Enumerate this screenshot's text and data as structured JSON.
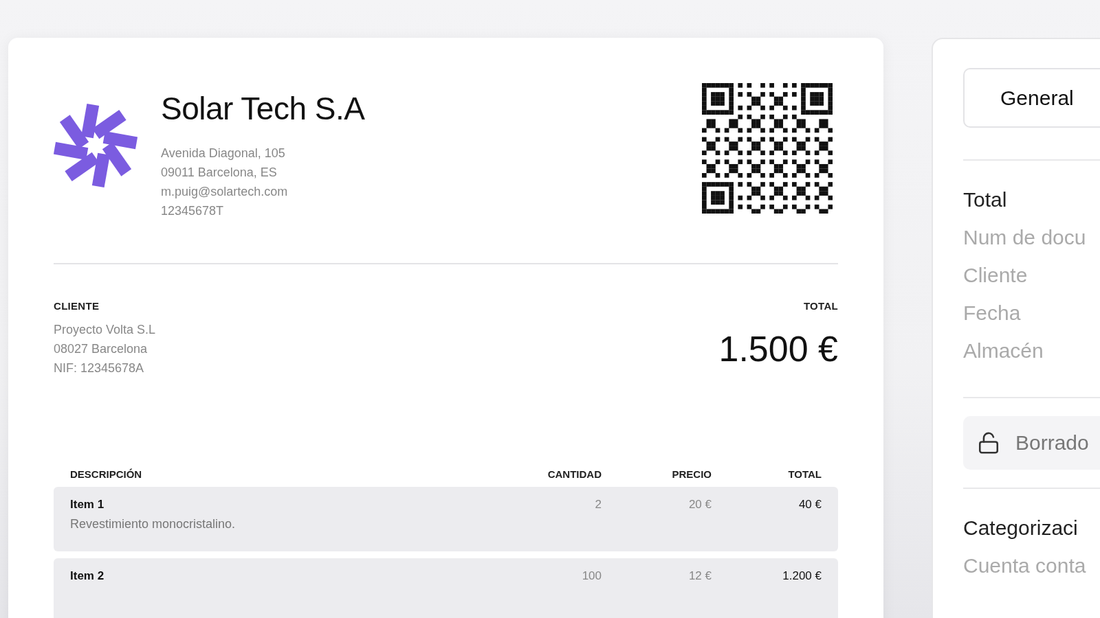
{
  "invoice": {
    "company": {
      "name": "Solar Tech S.A",
      "address_lines": [
        "Avenida Diagonal, 105",
        "09011 Barcelona, ES",
        "m.puig@solartech.com",
        "12345678T"
      ]
    },
    "client": {
      "label": "CLIENTE",
      "lines": [
        "Proyecto Volta S.L",
        "08027 Barcelona",
        "NIF: 12345678A"
      ]
    },
    "total": {
      "label": "TOTAL",
      "value": "1.500 €"
    },
    "table": {
      "columns": [
        "DESCRIPCIÓN",
        "CANTIDAD",
        "PRECIO",
        "TOTAL"
      ],
      "rows": [
        {
          "name": "Item 1",
          "description": "Revestimiento monocristalino.",
          "quantity": "2",
          "price": "20 €",
          "total": "40 €"
        },
        {
          "name": "Item 2",
          "quantity": "100",
          "price": "12 €",
          "total": "1.200 €"
        }
      ]
    }
  },
  "side_panel": {
    "tab": "General",
    "summary_title": "Total",
    "fields": [
      "Num de docu",
      "Cliente",
      "Fecha",
      "Almacén"
    ],
    "status": "Borrado",
    "section_title": "Categorizaci",
    "section_fields": [
      "Cuenta conta"
    ]
  }
}
